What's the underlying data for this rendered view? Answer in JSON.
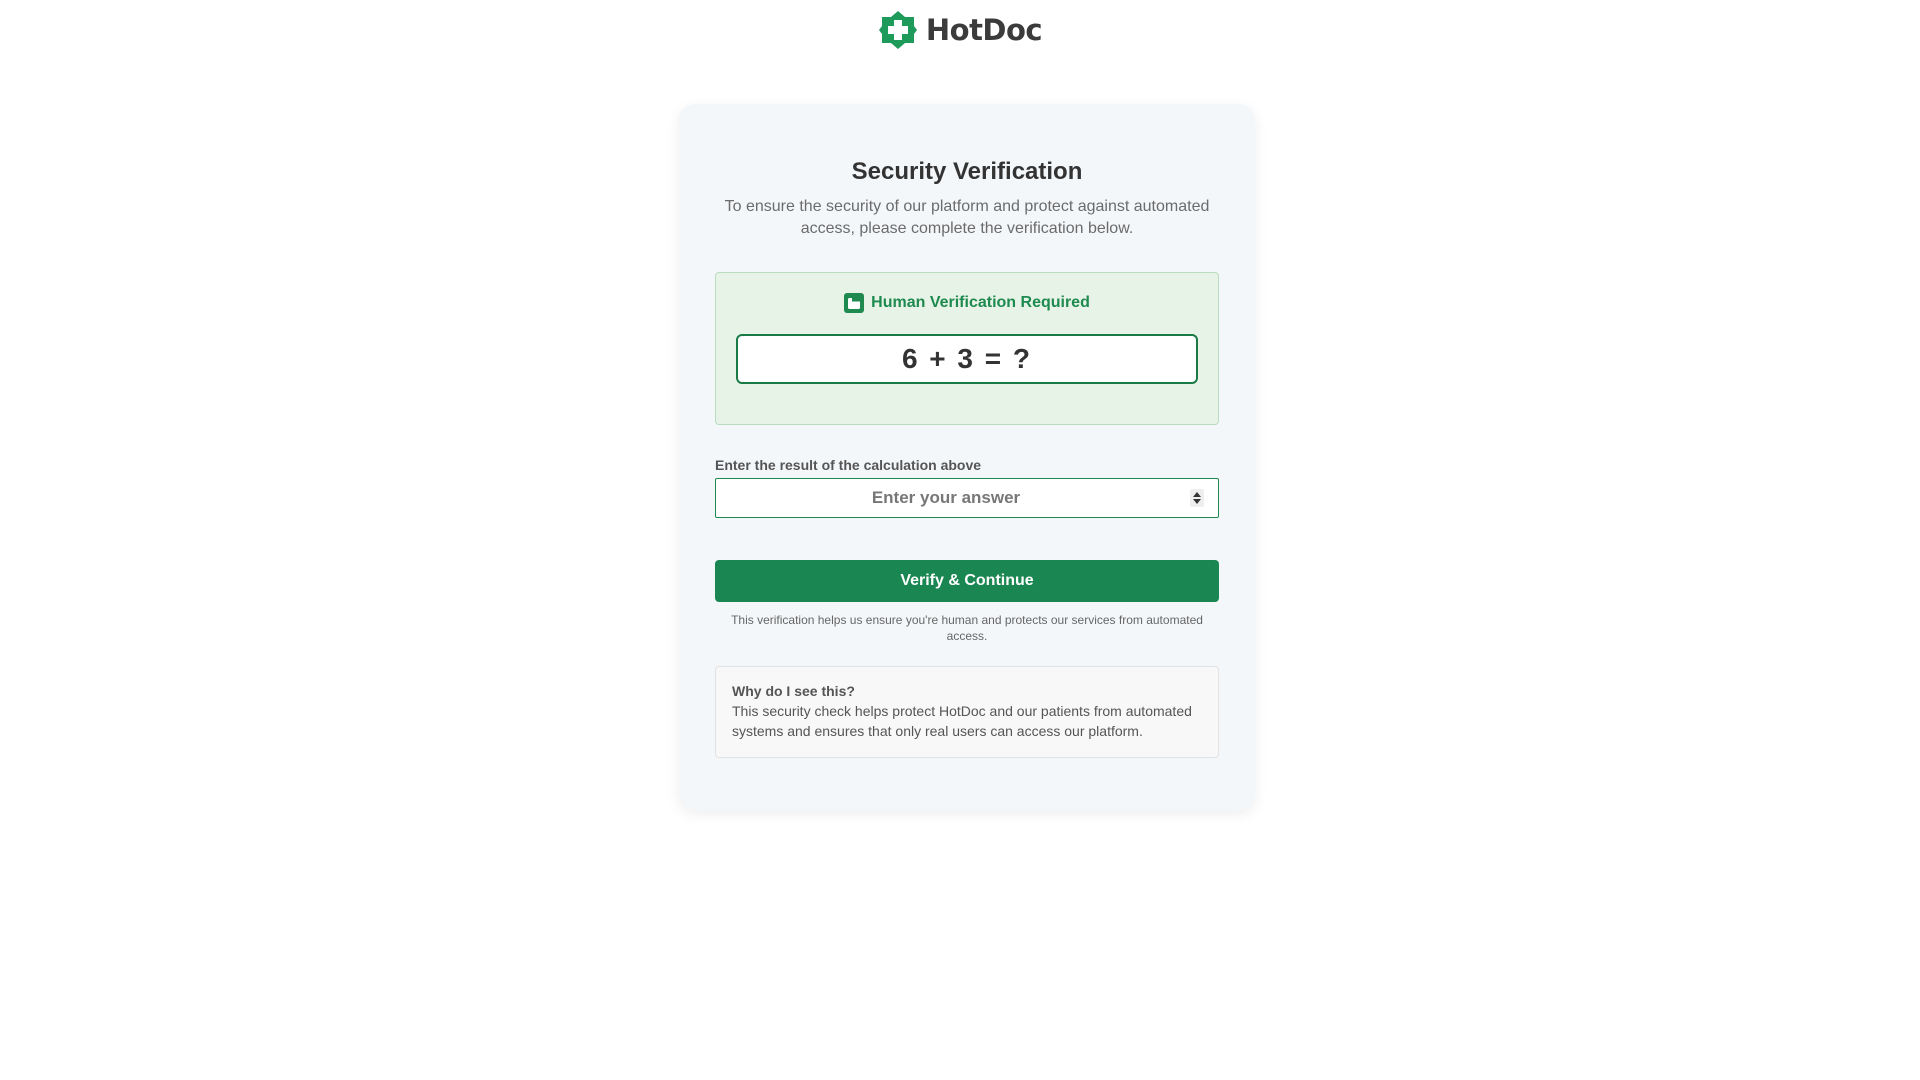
{
  "brand": {
    "name": "HotDoc",
    "icon": "medical-cross-icon",
    "color": "#1e8a4f"
  },
  "verification": {
    "title": "Security Verification",
    "subtitle": "To ensure the security of our platform and protect against automated access, please complete the verification below.",
    "box_label": "Human Verification Required",
    "box_icon": "shield-icon",
    "equation": "6 + 3 = ?",
    "answer_label": "Enter the result of the calculation above",
    "answer_placeholder": "Enter your answer",
    "answer_value": "",
    "button_label": "Verify & Continue",
    "help_note": "This verification helps us ensure you're human and protects our services from automated access."
  },
  "why": {
    "title": "Why do I see this?",
    "text": "This security check helps protect HotDoc and our patients from automated systems and ensures that only real users can access our platform."
  },
  "colors": {
    "accent": "#1a8752",
    "box_background": "#e8f3e8",
    "card_background": "#f4f7fa"
  }
}
